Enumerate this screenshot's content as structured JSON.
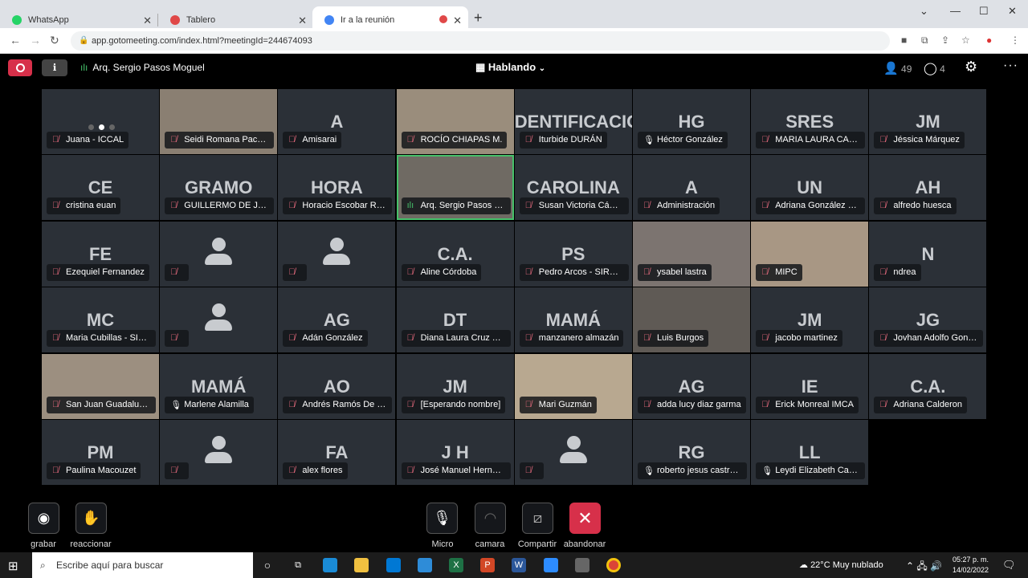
{
  "browser": {
    "tabs": [
      {
        "title": "WhatsApp",
        "icon": "whatsapp-icon",
        "color": "#25d366"
      },
      {
        "title": "Tablero",
        "icon": "tablero-icon",
        "color": "#e04848"
      },
      {
        "title": "Ir a la reunión",
        "icon": "google-icon",
        "color": "#4285f4",
        "active": true
      }
    ],
    "url": "app.gotomeeting.com/index.html?meetingId=244674093"
  },
  "meeting": {
    "presenter": "Arq. Sergio Pasos Moguel",
    "view_mode": "Hablando",
    "participants_count": "49",
    "chat_count": "4"
  },
  "tiles": [
    {
      "name": "Juana - ICCAL",
      "mic": "muted",
      "kind": "loading"
    },
    {
      "name": "Seidi Romana Pache...",
      "mic": "muted",
      "kind": "video"
    },
    {
      "name": "Amisarai",
      "mic": "muted",
      "initials": "A"
    },
    {
      "name": "ROCÍO CHIAPAS M.",
      "mic": "muted",
      "kind": "video"
    },
    {
      "name": "Iturbide DURÁN",
      "mic": "muted",
      "initials": "DENTIFICACIÓ"
    },
    {
      "name": "Héctor González",
      "mic": "on",
      "initials": "HG"
    },
    {
      "name": "MARIA LAURA CAL...",
      "mic": "muted",
      "initials": "SRES"
    },
    {
      "name": "Jéssica Márquez",
      "mic": "muted",
      "initials": "JM"
    },
    {
      "name": "cristina euan",
      "mic": "muted",
      "initials": "CE"
    },
    {
      "name": "GUILLERMO DE JES...",
      "mic": "muted",
      "initials": "GRAMO"
    },
    {
      "name": "Horacio Escobar Ra...",
      "mic": "muted",
      "initials": "HORA"
    },
    {
      "name": "Arq. Sergio Pasos M...",
      "mic": "talk",
      "kind": "video",
      "speaking": true
    },
    {
      "name": "Susan Victoria Cáma...",
      "mic": "muted",
      "initials": "CAROLINA"
    },
    {
      "name": "Administración",
      "mic": "muted",
      "initials": "A"
    },
    {
      "name": "Adriana González N...",
      "mic": "muted",
      "initials": "UN"
    },
    {
      "name": "alfredo huesca",
      "mic": "muted",
      "initials": "AH"
    },
    {
      "name": "Ezequiel Fernandez",
      "mic": "muted",
      "initials": "FE"
    },
    {
      "name": "",
      "mic": "muted",
      "kind": "avatar"
    },
    {
      "name": "",
      "mic": "muted",
      "kind": "avatar"
    },
    {
      "name": "Aline Córdoba",
      "mic": "muted",
      "initials": "C.A."
    },
    {
      "name": "Pedro Arcos - SIRES...",
      "mic": "muted",
      "initials": "PS"
    },
    {
      "name": "ysabel lastra",
      "mic": "muted",
      "kind": "video"
    },
    {
      "name": "MIPC",
      "mic": "muted",
      "kind": "video"
    },
    {
      "name": "ndrea",
      "mic": "muted",
      "initials": "N"
    },
    {
      "name": "Maria Cubillas - SIR...",
      "mic": "muted",
      "initials": "MC"
    },
    {
      "name": "",
      "mic": "muted",
      "kind": "avatar"
    },
    {
      "name": "Adán González",
      "mic": "muted",
      "initials": "AG"
    },
    {
      "name": "Diana Laura Cruz Tu...",
      "mic": "muted",
      "initials": "DT"
    },
    {
      "name": "manzanero almazán",
      "mic": "muted",
      "initials": "MAMÁ"
    },
    {
      "name": "Luis Burgos",
      "mic": "muted",
      "kind": "video"
    },
    {
      "name": "jacobo martinez",
      "mic": "muted",
      "initials": "JM"
    },
    {
      "name": "Jovhan Adolfo Gonz...",
      "mic": "muted",
      "initials": "JG"
    },
    {
      "name": "San Juan Guadalupe...",
      "mic": "muted",
      "kind": "video"
    },
    {
      "name": "Marlene Alamilla",
      "mic": "on",
      "initials": "MAMÁ"
    },
    {
      "name": "Andrés Ramós De L...",
      "mic": "muted",
      "initials": "AO"
    },
    {
      "name": "[Esperando nombre]",
      "mic": "muted",
      "initials": "JM"
    },
    {
      "name": "Mari Guzmán",
      "mic": "muted",
      "kind": "video"
    },
    {
      "name": "adda lucy diaz garma",
      "mic": "muted",
      "initials": "AG"
    },
    {
      "name": "Erick Monreal IMCA",
      "mic": "muted",
      "initials": "IE"
    },
    {
      "name": "Adriana Calderon",
      "mic": "muted",
      "initials": "C.A."
    },
    {
      "name": "Paulina Macouzet",
      "mic": "muted",
      "initials": "PM"
    },
    {
      "name": "",
      "mic": "muted",
      "kind": "avatar"
    },
    {
      "name": "alex flores",
      "mic": "muted",
      "initials": "FA"
    },
    {
      "name": "José Manuel Hernán...",
      "mic": "muted",
      "initials": "J H"
    },
    {
      "name": "",
      "mic": "muted",
      "kind": "avatar"
    },
    {
      "name": "roberto jesus castro ...",
      "mic": "on",
      "initials": "RG"
    },
    {
      "name": "Leydi Elizabeth Cast...",
      "mic": "on",
      "initials": "LL"
    }
  ],
  "controls": {
    "record": "grabar",
    "react": "reaccionar",
    "mic": "Micro",
    "camera": "camara",
    "share": "Compartir",
    "leave": "abandonar"
  },
  "taskbar": {
    "search_placeholder": "Escribe aquí para buscar",
    "weather": "22°C  Muy nublado",
    "time": "05:27 p. m.",
    "date": "14/02/2022"
  }
}
